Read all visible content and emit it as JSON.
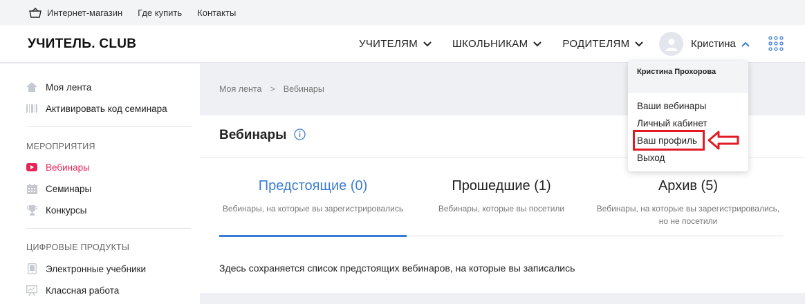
{
  "topbar": {
    "shop": "Интернет-магазин",
    "where_buy": "Где купить",
    "contacts": "Контакты"
  },
  "header": {
    "logo": "УЧИТЕЛЬ. CLUB",
    "nav": [
      "УЧИТЕЛЯМ",
      "ШКОЛЬНИКАМ",
      "РОДИТЕЛЯМ"
    ],
    "username": "Кристина"
  },
  "sidebar": {
    "top_items": [
      "Моя лента",
      "Активировать код семинара"
    ],
    "events_heading": "МЕРОПРИЯТИЯ",
    "events_items": [
      "Вебинары",
      "Семинары",
      "Конкурсы"
    ],
    "digital_heading": "ЦИФРОВЫЕ ПРОДУКТЫ",
    "digital_items": [
      "Электронные учебники",
      "Классная работа"
    ]
  },
  "breadcrumb": [
    "Моя лента",
    "Вебинары"
  ],
  "page": {
    "title": "Вебинары"
  },
  "tabs": [
    {
      "label": "Предстоящие (0)",
      "desc": "Вебинары, на которые вы зарегистрировались"
    },
    {
      "label": "Прошедшие (1)",
      "desc": "Вебинары, которые вы посетили"
    },
    {
      "label": "Архив (5)",
      "desc": "Вебинары, на которые вы зарегистрировались, но не посетили"
    }
  ],
  "empty_message": "Здесь сохраняется список предстоящих вебинаров, на которые вы записались",
  "user_menu": {
    "full_name": "Кристина Прохорова",
    "items": [
      "Ваши вебинары",
      "Личный кабинет",
      "Ваш профиль",
      "Выход"
    ]
  },
  "colors": {
    "accent_blue": "#3c7bd4",
    "active_pink": "#e6265b",
    "highlight_red": "#e01b24"
  }
}
